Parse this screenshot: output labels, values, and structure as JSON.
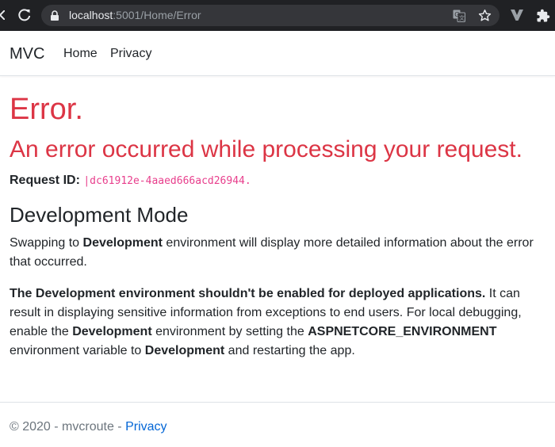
{
  "browser": {
    "url_host": "localhost",
    "url_rest": ":5001/Home/Error",
    "icons": [
      "back-arrow-icon",
      "reload-icon",
      "lock-icon",
      "translate-icon",
      "star-icon",
      "extension-v-icon",
      "puzzle-icon"
    ]
  },
  "header": {
    "brand": "MVC",
    "nav": [
      {
        "label": "Home"
      },
      {
        "label": "Privacy"
      }
    ]
  },
  "main": {
    "title": "Error.",
    "subtitle": "An error occurred while processing your request.",
    "request_id_label": "Request ID:",
    "request_id_value": "|dc61912e-4aaed666acd26944.",
    "dev_heading": "Development Mode",
    "para1": {
      "prefix": "Swapping to ",
      "bold": "Development",
      "suffix": " environment will display more detailed information about the error that occurred."
    },
    "para2": {
      "bold1": "The Development environment shouldn't be enabled for deployed applications.",
      "text1": " It can result in displaying sensitive information from exceptions to end users. For local debugging, enable the ",
      "bold2": "Development",
      "text2": " environment by setting the ",
      "bold3": "ASPNETCORE_ENVIRONMENT",
      "text3": " environment variable to ",
      "bold4": "Development",
      "text4": " and restarting the app."
    }
  },
  "footer": {
    "text": "© 2020 - mvcroute - ",
    "link": "Privacy"
  },
  "colors": {
    "error_red": "#dc3545",
    "code_pink": "#e83e8c",
    "link_blue": "#0366d6",
    "chrome_dark": "#202124"
  }
}
